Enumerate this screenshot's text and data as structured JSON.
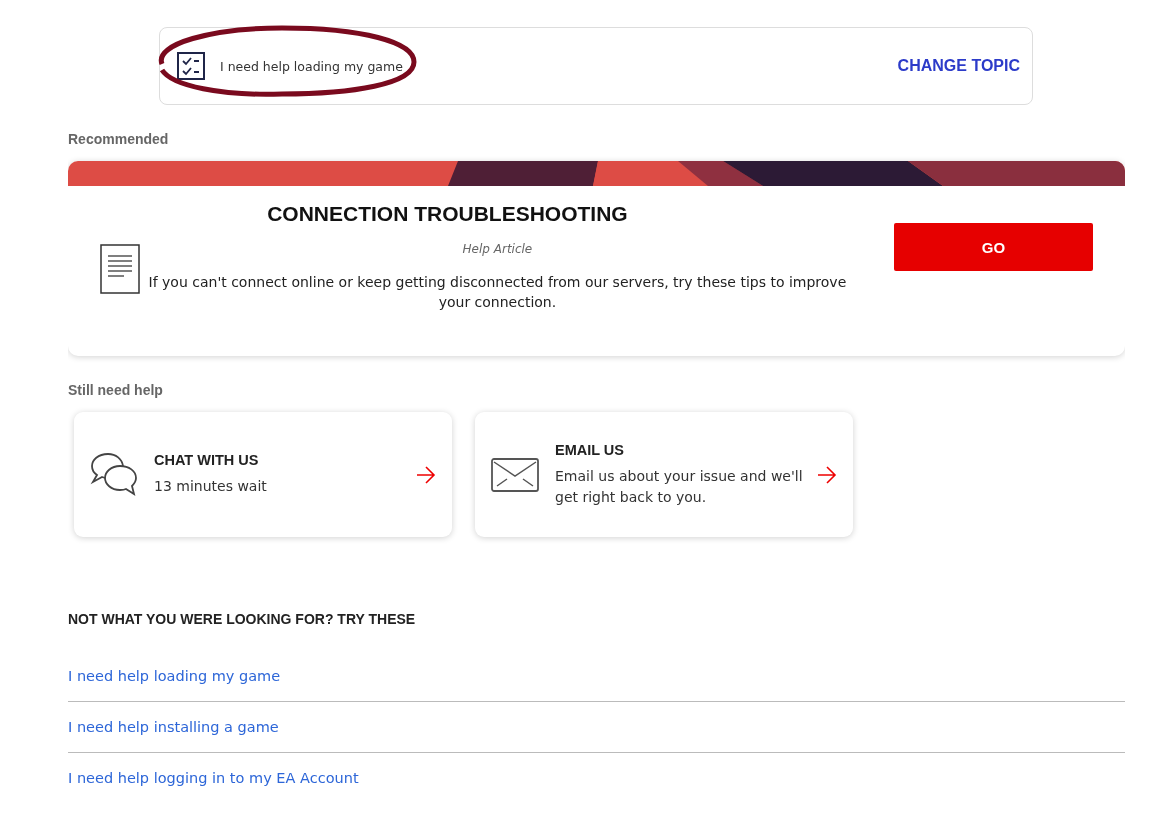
{
  "topic": {
    "label": "I need help loading my game",
    "action": "CHANGE TOPIC"
  },
  "recommended": {
    "heading": "Recommended",
    "title": "CONNECTION TROUBLESHOOTING",
    "type": "Help Article",
    "description": "If you can't connect online or keep getting disconnected from our servers, try these tips to improve your connection.",
    "button": "GO"
  },
  "still_need_help": {
    "heading": "Still need help",
    "options": [
      {
        "kind": "chat",
        "title": "CHAT WITH US",
        "detail": "13 minutes wait"
      },
      {
        "kind": "email",
        "title": "EMAIL US",
        "detail": "Email us about your issue and we'll get right back to you."
      }
    ]
  },
  "suggestions": {
    "heading": "NOT WHAT YOU WERE LOOKING FOR? TRY THESE",
    "links": [
      "I need help loading my game",
      "I need help installing a game",
      "I need help logging in to my EA Account"
    ]
  }
}
